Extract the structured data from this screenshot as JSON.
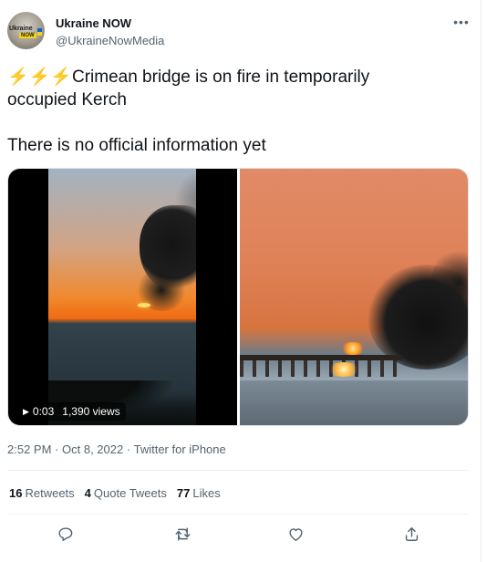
{
  "tweet": {
    "author": {
      "name": "Ukraine NOW",
      "handle": "@UkraineNowMedia",
      "avatar_text": "Ukraine",
      "avatar_badge": "NOW"
    },
    "more_icon": "more-dots-icon",
    "line1_emoji": "⚡⚡⚡",
    "line1": "Crimean bridge is on fire in temporarily",
    "line2": "occupied Kerch",
    "line3": "There is no official information yet",
    "video": {
      "duration": "0:03",
      "views": "1,390 views"
    },
    "time": "2:52 PM",
    "date": "Oct 8, 2022",
    "source": "Twitter for iPhone",
    "separator": "·",
    "stats": {
      "retweets_count": "16",
      "retweets_label": "Retweets",
      "quotes_count": "4",
      "quotes_label": "Quote Tweets",
      "likes_count": "77",
      "likes_label": "Likes"
    },
    "actions": [
      "reply-icon",
      "retweet-icon",
      "like-icon",
      "share-icon"
    ]
  },
  "colors": {
    "text": "#0f1419",
    "secondary": "#536471",
    "border": "#eff3f4"
  }
}
